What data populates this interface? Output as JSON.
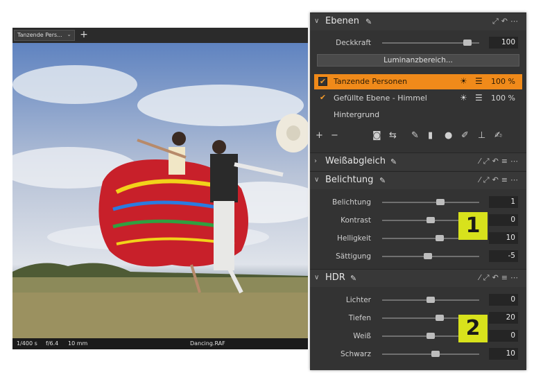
{
  "viewer": {
    "tab_label": "Tanzende Pers...",
    "tab_chevron": "⌄",
    "add_tab": "+",
    "status": {
      "shutter": "1/400 s",
      "aperture": "f/6.4",
      "focal": "10 mm",
      "filename": "Dancing.RAF"
    }
  },
  "layers_panel": {
    "title": "Ebenen",
    "opacity_label": "Deckkraft",
    "opacity_value": "100",
    "opacity_fraction": 0.88,
    "luminance_button": "Luminanzbereich...",
    "layers": [
      {
        "name": "Tanzende Personen",
        "percent": "100 %",
        "checked": true,
        "active": true
      },
      {
        "name": "Gefüllte Ebene - Himmel",
        "percent": "100 %",
        "checked": true,
        "active": false
      },
      {
        "name": "Hintergrund",
        "percent": "",
        "checked": false,
        "active": false
      }
    ],
    "toolbar_icons": [
      "plus-icon",
      "minus-icon",
      "mask-icon",
      "swap-icon",
      "brush-icon",
      "gradient-icon",
      "radial-icon",
      "eraser-icon",
      "stamp-icon",
      "pen-icon"
    ]
  },
  "white_balance": {
    "title": "Weißabgleich"
  },
  "exposure": {
    "title": "Belichtung",
    "rows": [
      {
        "label": "Belichtung",
        "value": "1",
        "fraction": 0.6
      },
      {
        "label": "Kontrast",
        "value": "0",
        "fraction": 0.5
      },
      {
        "label": "Helligkeit",
        "value": "10",
        "fraction": 0.59
      },
      {
        "label": "Sättigung",
        "value": "-5",
        "fraction": 0.47
      }
    ]
  },
  "hdr": {
    "title": "HDR",
    "rows": [
      {
        "label": "Lichter",
        "value": "0",
        "fraction": 0.5
      },
      {
        "label": "Tiefen",
        "value": "20",
        "fraction": 0.59
      },
      {
        "label": "Weiß",
        "value": "0",
        "fraction": 0.5
      },
      {
        "label": "Schwarz",
        "value": "10",
        "fraction": 0.55
      }
    ]
  },
  "badges": {
    "one": "1",
    "two": "2"
  },
  "colors": {
    "accent": "#f08a1a",
    "badge": "#d8e21c",
    "panel": "#333333"
  }
}
